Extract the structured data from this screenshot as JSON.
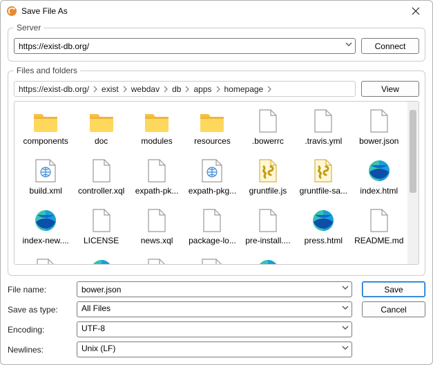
{
  "window": {
    "title": "Save File As"
  },
  "server": {
    "legend": "Server",
    "url": "https://exist-db.org/",
    "connect_label": "Connect"
  },
  "filesFolders": {
    "legend": "Files and folders",
    "view_label": "View",
    "breadcrumbs": [
      "https://exist-db.org/",
      "exist",
      "webdav",
      "db",
      "apps",
      "homepage"
    ]
  },
  "items": [
    {
      "name": "components",
      "type": "folder"
    },
    {
      "name": "doc",
      "type": "folder"
    },
    {
      "name": "modules",
      "type": "folder"
    },
    {
      "name": "resources",
      "type": "folder"
    },
    {
      "name": ".bowerrc",
      "type": "file"
    },
    {
      "name": ".travis.yml",
      "type": "file"
    },
    {
      "name": "bower.json",
      "type": "file"
    },
    {
      "name": "build.xml",
      "type": "xml"
    },
    {
      "name": "controller.xql",
      "type": "file"
    },
    {
      "name": "expath-pk...",
      "type": "file"
    },
    {
      "name": "expath-pkg...",
      "type": "xml"
    },
    {
      "name": "gruntfile.js",
      "type": "js"
    },
    {
      "name": "gruntfile-sa...",
      "type": "js"
    },
    {
      "name": "index.html",
      "type": "html"
    },
    {
      "name": "index-new....",
      "type": "html"
    },
    {
      "name": "LICENSE",
      "type": "file"
    },
    {
      "name": "news.xql",
      "type": "file"
    },
    {
      "name": "package-lo...",
      "type": "file"
    },
    {
      "name": "pre-install....",
      "type": "file"
    },
    {
      "name": "press.html",
      "type": "html"
    },
    {
      "name": "README.md",
      "type": "file"
    },
    {
      "name": "",
      "type": "file"
    },
    {
      "name": "",
      "type": "html"
    },
    {
      "name": "",
      "type": "file"
    },
    {
      "name": "",
      "type": "xml"
    },
    {
      "name": "",
      "type": "html"
    }
  ],
  "form": {
    "file_name_label": "File name:",
    "file_name_value": "bower.json",
    "save_as_type_label": "Save as type:",
    "save_as_type_value": "All Files",
    "encoding_label": "Encoding:",
    "encoding_value": "UTF-8",
    "newlines_label": "Newlines:",
    "newlines_value": "Unix (LF)",
    "save_label": "Save",
    "cancel_label": "Cancel"
  }
}
